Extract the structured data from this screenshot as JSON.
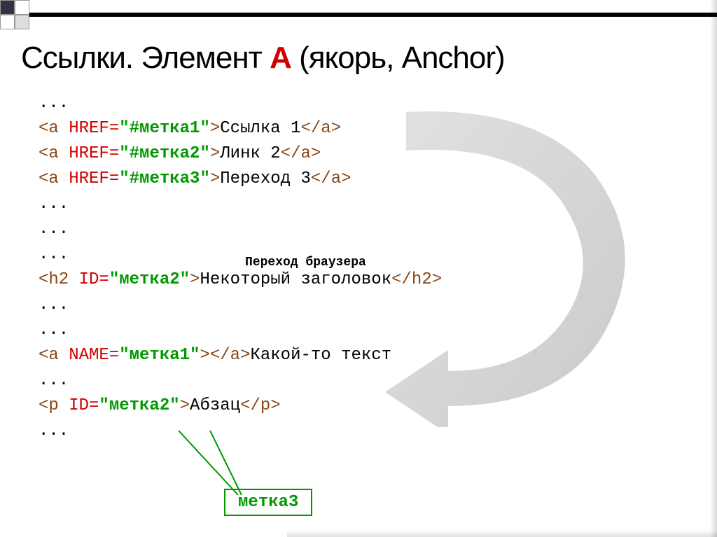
{
  "title_prefix": "Ссылки. Элемент ",
  "title_a": "A",
  "title_suffix": " (якорь, Anchor)",
  "code": {
    "dots": "...",
    "a_open": "<a",
    "href": " HREF=",
    "close_gt": ">",
    "a_close": "</a>",
    "link1_href": "\"#метка1\"",
    "link1_text": "Ссылка 1",
    "link2_href": "\"#метка2\"",
    "link2_text": "Линк 2",
    "link3_href": "\"#метка3\"",
    "link3_text": "Переход 3",
    "h2_open": "<h2",
    "id_attr": " ID=",
    "h2_id": "\"метка2\"",
    "h2_text": "Некоторый заголовок",
    "h2_close": "</h2>",
    "name_attr": " NAME=",
    "a_name_val": "\"метка1\"",
    "a_name_text": "Какой-то текст",
    "p_open": "<p",
    "p_id": "\"метка2\"",
    "p_text": "Абзац",
    "p_close": "</p>"
  },
  "transition_label": "Переход браузера",
  "label_box": "метка3"
}
